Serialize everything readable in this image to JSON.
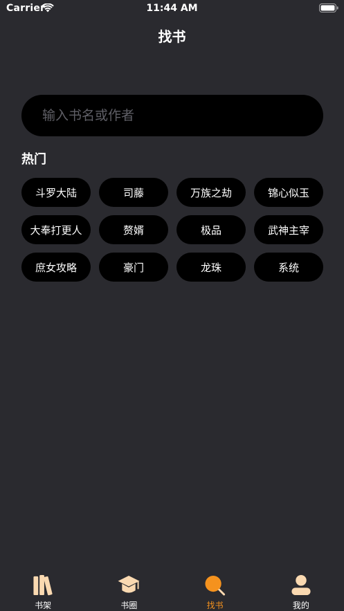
{
  "status_bar": {
    "carrier": "Carrier",
    "time": "11:44 AM"
  },
  "nav": {
    "title": "找书"
  },
  "search": {
    "placeholder": "输入书名或作者",
    "value": ""
  },
  "hot": {
    "title": "热门",
    "tags": [
      "斗罗大陆",
      "司藤",
      "万族之劫",
      "锦心似玉",
      "大奉打更人",
      "赘婿",
      "极品",
      "武神主宰",
      "庶女攻略",
      "豪门",
      "龙珠",
      "系统"
    ]
  },
  "tab_bar": {
    "items": [
      {
        "label": "书架",
        "icon": "bookshelf-icon",
        "active": false
      },
      {
        "label": "书圈",
        "icon": "graduation-cap-icon",
        "active": false
      },
      {
        "label": "找书",
        "icon": "search-icon",
        "active": true
      },
      {
        "label": "我的",
        "icon": "user-icon",
        "active": false
      }
    ]
  },
  "colors": {
    "background": "#2a2a2f",
    "pill": "#000000",
    "accent": "#f5921e",
    "icon_inactive": "#fad9b1"
  }
}
